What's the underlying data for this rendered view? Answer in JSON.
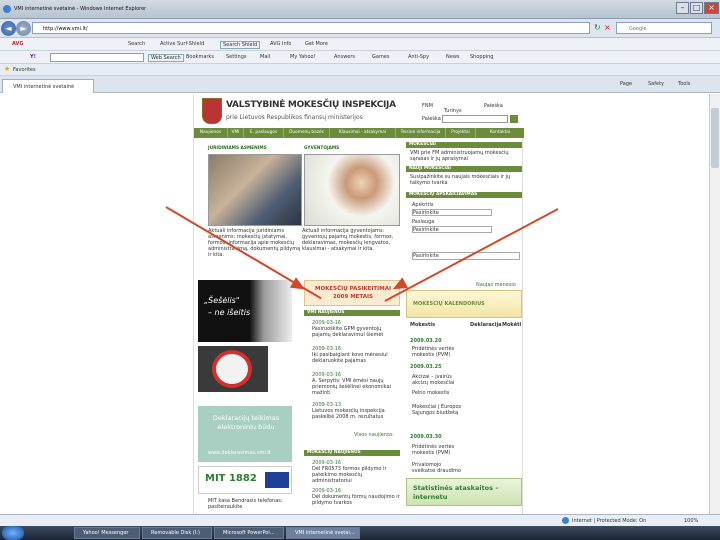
{
  "window": {
    "title": "VMI internetinė svetainė - Windows Internet Explorer",
    "url": "http://www.vmi.lt/",
    "search_placeholder": "Google",
    "nav": {
      "back": "◄",
      "forward": "►"
    },
    "toolbar1": {
      "items": [
        "AVG",
        "Search",
        "Active Surf-Shield",
        "Search Shield",
        "AVG Info",
        "Get More"
      ]
    },
    "toolbar2": {
      "items": [
        "Web Search",
        "Bookmarks",
        "Settings",
        "Mail",
        "My Yahoo!",
        "Answers",
        "Games",
        "Anti-Spy",
        "News",
        "Shopping"
      ]
    },
    "favorites": {
      "label": "Favorites"
    },
    "tab": {
      "label": "VMI internetinė svetainė"
    },
    "command_bar": [
      "Page",
      "Safety",
      "Tools"
    ],
    "status": {
      "zone": "Internet | Protected Mode: On",
      "zoom": "100%"
    },
    "taskbar": [
      "Yahoo! Messenger",
      "Removable Disk (I:)",
      "Microsoft PowerPoi...",
      "VMI internetinė svetai..."
    ]
  },
  "site": {
    "title": "VALSTYBINĖ MOKESČIŲ INSPEKCIJA",
    "subtitle": "prie Lietuvos Respublikos finansų ministerijos",
    "lang": [
      "FNM",
      "Turinys",
      "Paieška"
    ],
    "search_label": "Paieška",
    "menu": [
      "Naujienos",
      "VMI",
      "E. paslaugos",
      "Duomenų bazės",
      "Klausimai - atsakymai",
      "Teisinė informacija",
      "Projektai",
      "Kontaktai"
    ],
    "legal_persons": {
      "heading": "JURIDINIAMS ASMENIMS",
      "text": "Aktuali informacija juridiniams asmenims: mokesčių įstatymai, formos, informacija apie mokesčių administravimą, dokumentų pildymą ir kita."
    },
    "individuals": {
      "heading": "GYVENTOJAMS",
      "text": "Aktuali informacija gyventojams: gyventojų pajamų mokestis, formos, deklaravimas, mokesčių lengvatos, klausimai - atsakymai ir kita."
    },
    "right": {
      "sections": [
        "MOKESČIAI",
        "NAUJI MOKESČIAI",
        "MOKESČIŲ APSKAIČIAVIMAS"
      ],
      "gpm": "VMI prie FM administruojamų mokesčių sąrašas ir jų aprašymai",
      "new_taxes": "Susipažinkite su naujais mokesčiais ir jų taikymo tvarka",
      "calc_labels": [
        "Apskritis",
        "Paslauga"
      ],
      "calc_values": [
        "Pasirinkite",
        "Pasirinkite",
        "Pasirinkite"
      ]
    },
    "promo": {
      "line1": "„Šešėlis\"",
      "line2": "– ne išeitis",
      "decl": "Deklaracijų teikimas elektroniniu būdu",
      "decl_url": "www.deklaravimas.vmi.lt",
      "mit": "MIT 1882",
      "mit_text": "MIT kasa Bendrasis telefonas: pasiteiraukite"
    },
    "calendar": {
      "line1": "MOKESČIŲ PASIKEITIMAI",
      "line2": "2009 METAIS"
    },
    "news": {
      "heading": "VMI NAUJIENOS",
      "items": [
        {
          "date": "2009-03-16",
          "text": "Pasiruoškite GPM gyventojų pajamų deklaravimui šiemet"
        },
        {
          "date": "2009-03-16",
          "text": "Iki pasibaigiant kovo mėnesiui deklaruokite pajamas"
        },
        {
          "date": "2009-03-16",
          "text": "A. Šerpytis: VMI ėmėsi naujų priemonių šešėlinei ekonomikai mažinti"
        },
        {
          "date": "2009-03-13",
          "text": "Lietuvos mokesčių inspekcija paskelbė 2008 m. rezultatus"
        }
      ],
      "more": "Visos naujienos"
    },
    "tax_news": {
      "heading": "MOKESČIŲ NAUJIENOS",
      "items": [
        {
          "date": "2009-03-16",
          "text": "Dėl FR0573 formos pildymo ir pateikimo mokesčių administratoriui"
        },
        {
          "date": "2009-03-16",
          "text": "Dėl dokumentų formų naudojimo ir pildymo tvarkos"
        }
      ]
    },
    "tax_calendar": {
      "top": "Naujas mėnesio",
      "banner": "MOKESČIŲ KALENDORIUS",
      "cols": [
        "Mokestis",
        "Deklaracija",
        "Mokėti"
      ],
      "groups": [
        {
          "date": "2009.03.20",
          "rows": [
            "Pridėtinės vertės mokestis (PVM)"
          ]
        },
        {
          "date": "2009.03.25",
          "rows": [
            "Akcizai – įvairūs akcizų mokesčiai",
            "Pelno mokestis",
            "Mokesčiai į Europos Sąjungos biudžetą"
          ]
        },
        {
          "date": "2009.03.30",
          "rows": [
            "Pridėtinės vertės mokestis (PVM)",
            "Privalomojo sveikatos draudimo įmokos"
          ]
        }
      ],
      "stats": "Statistinės ataskaitos – internetu"
    }
  }
}
